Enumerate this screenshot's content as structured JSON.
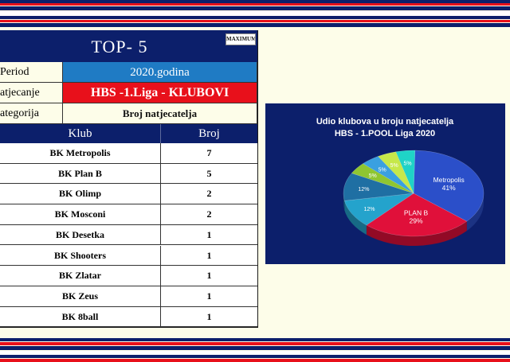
{
  "colors": {
    "navy": "#0c1f6b",
    "period_blue": "#1f7bc4",
    "red": "#e8101b",
    "cream": "#fdfde9"
  },
  "table": {
    "title": "TOP- 5",
    "logo": "MAXIMUM",
    "period_label": "Period",
    "period_value": "2020.godina",
    "competition_label": "atjecanje",
    "competition_value": "HBS -1.Liga - KLUBOVI",
    "category_label": "ategorija",
    "category_value": "Broj natjecatelja",
    "col_club": "Klub",
    "col_count": "Broj",
    "rows": [
      {
        "club": "BK Metropolis",
        "count": "7"
      },
      {
        "club": "BK Plan B",
        "count": "5"
      },
      {
        "club": "BK Olimp",
        "count": "2"
      },
      {
        "club": "BK Mosconi",
        "count": "2"
      },
      {
        "club": "BK Desetka",
        "count": "1"
      },
      {
        "club": "BK Shooters",
        "count": "1"
      },
      {
        "club": "BK Zlatar",
        "count": "1"
      },
      {
        "club": "BK Zeus",
        "count": "1"
      },
      {
        "club": "BK 8ball",
        "count": "1"
      }
    ]
  },
  "chart_data": {
    "type": "pie",
    "title": "Udio klubova u broju natjecatelja",
    "subtitle": "HBS - 1.POOL Liga 2020",
    "slices": [
      {
        "label": "Metropolis",
        "value": 41,
        "text": "41%",
        "color": "#2b4fc9"
      },
      {
        "label": "PLAN B",
        "value": 29,
        "text": "29%",
        "color": "#e0103a"
      },
      {
        "label": "",
        "value": 12,
        "text": "12%",
        "color": "#24a3cc"
      },
      {
        "label": "",
        "value": 12,
        "text": "12%",
        "color": "#1f6fa3"
      },
      {
        "label": "",
        "value": 5,
        "text": "5%",
        "color": "#8fc631"
      },
      {
        "label": "",
        "value": 5,
        "text": "5%",
        "color": "#3aa0e0"
      },
      {
        "label": "",
        "value": 5,
        "text": "5%",
        "color": "#c6e84a"
      },
      {
        "label": "",
        "value": 5,
        "text": "5%",
        "color": "#1fd3c7"
      }
    ]
  }
}
